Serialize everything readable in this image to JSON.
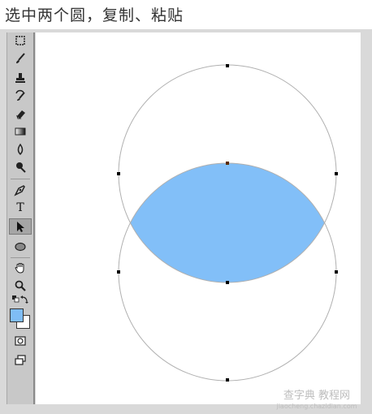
{
  "caption": "选中两个圆，复制、粘贴",
  "toolbar": {
    "tools": [
      {
        "name": "crop-icon"
      },
      {
        "name": "brush-icon"
      },
      {
        "name": "clone-stamp-icon"
      },
      {
        "name": "history-brush-icon"
      },
      {
        "name": "eraser-icon"
      },
      {
        "name": "gradient-icon"
      },
      {
        "name": "blur-icon"
      },
      {
        "name": "dodge-icon"
      },
      {
        "name": "pen-icon"
      },
      {
        "name": "type-icon",
        "label": "T"
      },
      {
        "name": "path-selection-icon",
        "active": true
      },
      {
        "name": "ellipse-shape-icon"
      },
      {
        "name": "hand-icon"
      },
      {
        "name": "zoom-icon"
      },
      {
        "name": "default-colors-icon"
      },
      {
        "name": "swap-colors-icon"
      },
      {
        "name": "quick-mask-icon"
      },
      {
        "name": "screen-mode-icon"
      }
    ],
    "foreground_color": "#7fbdf5",
    "background_color": "#ffffff"
  },
  "canvas": {
    "circle_stroke_color": "#b0b0b0",
    "intersection_fill_color": "#82bff8",
    "anchor_color": "#000000"
  },
  "watermark": {
    "line1": "查字典 教程网",
    "line2": "jiaocheng.chazidian.com"
  }
}
